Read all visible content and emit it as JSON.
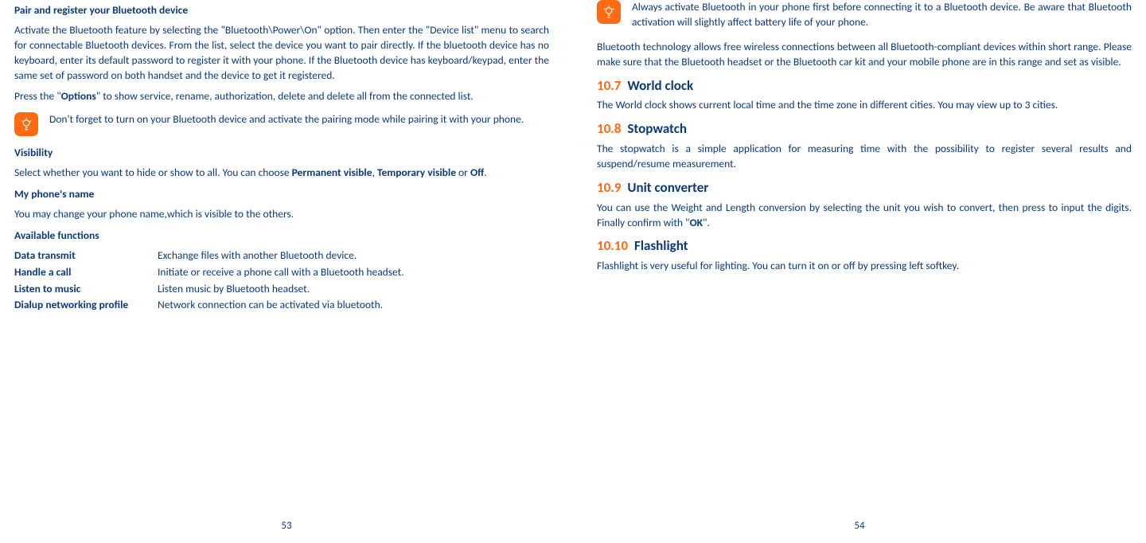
{
  "left": {
    "h1": "Pair and register your Bluetooth device",
    "p1": "Activate the Bluetooth feature by selecting the \"Bluetooth\\Power\\On\" option. Then enter the \"Device list\" menu to search for connectable Bluetooth devices. From the list, select the device you want to pair directly. If the bluetooth device has no keyboard, enter its default password to register it with your phone. If the Bluetooth device has keyboard/keypad, enter the same set of password on both handset and the device to get it registered.",
    "p2a": "Press the \"",
    "p2b": "Options",
    "p2c": "\" to show service, rename, authorization, delete and delete all from the connected list.",
    "note1": "Don't forget to turn on your Bluetooth device and activate the pairing mode while pairing it with your phone.",
    "h2": "Visibility",
    "p3a": "Select whether you want to hide or show to all. You can choose ",
    "p3b": "Permanent visible",
    "p3c": ", ",
    "p3d": "Temporary visible",
    "p3e": " or ",
    "p3f": "Off",
    "p3g": ".",
    "h3": "My phone's name",
    "p4": "You may change your phone name,which is visible to the others.",
    "h4": "Available functions",
    "funcs": [
      {
        "label": "Data transmit",
        "desc": "Exchange files with another Bluetooth device."
      },
      {
        "label": "Handle a call",
        "desc": "Initiate or receive a phone call with a Bluetooth headset."
      },
      {
        "label": "Listen to music",
        "desc": "Listen music by Bluetooth headset."
      },
      {
        "label": "Dialup networking profile",
        "desc": "Network connection can be activated via bluetooth."
      }
    ],
    "pagenum": "53"
  },
  "right": {
    "note1": "Always activate Bluetooth in your phone first before connecting it to a Bluetooth device. Be aware that Bluetooth activation will slightly affect battery life of your phone.",
    "p1": "Bluetooth technology allows free wireless connections between all Bluetooth-compliant devices within short range. Please make sure that the Bluetooth headset or the Bluetooth car kit and your mobile phone are in this range and set as visible.",
    "s107n": "10.7",
    "s107t": "World clock",
    "p107": "The World clock shows current local time and the time zone in different cities. You may view up to 3 cities.",
    "s108n": "10.8",
    "s108t": "Stopwatch",
    "p108": "The stopwatch is a simple application for measuring time with the possibility to register several results and suspend/resume measurement.",
    "s109n": "10.9",
    "s109t": "Unit converter",
    "p109a": "You can use the Weight and Length conversion by selecting the unit you wish to convert, then press to input the digits. Finally confirm with \"",
    "p109b": "OK",
    "p109c": "\".",
    "s1010n": "10.10",
    "s1010t": "Flashlight",
    "p1010": "Flashlight is very useful for lighting. You can turn it on or off by pressing left softkey.",
    "pagenum": "54"
  }
}
